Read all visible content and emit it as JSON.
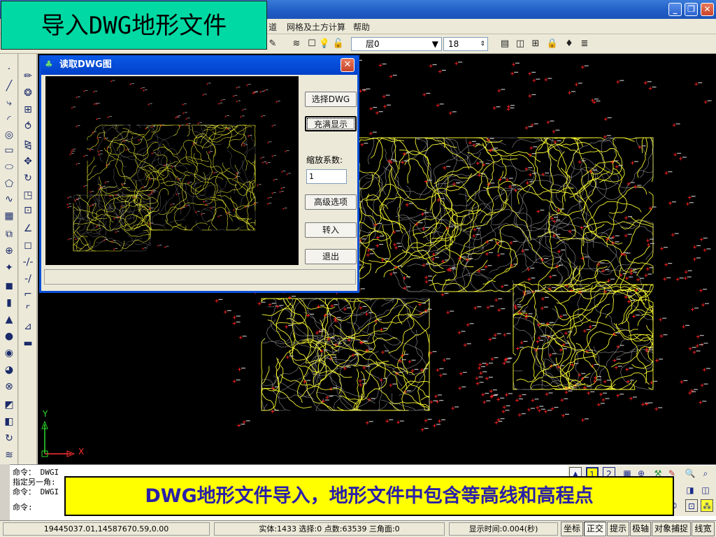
{
  "heading": "导入DWG地形文件",
  "menu": {
    "items": [
      "道",
      "网格及土方计算",
      "帮助"
    ]
  },
  "toolbar": {
    "layer": "层0",
    "size": "18"
  },
  "dialog": {
    "title": "读取DWG图",
    "buttons": [
      "选择DWG",
      "充满显示",
      "高级选项",
      "转入",
      "退出"
    ],
    "zoom_label": "缩放系数:",
    "zoom_value": "1"
  },
  "command": {
    "lines": [
      "命令： DWGI",
      "指定另一角:",
      "命令： DWGI"
    ],
    "prompt": "命令:"
  },
  "caption": "DWG地形文件导入，地形文件中包含等高线和高程点",
  "axis": {
    "y": "Y",
    "x": "X"
  },
  "status": {
    "coords": "19445037.01,14587670.59,0.00",
    "info": "实体:1433 选择:0 点数:63539 三角面:0",
    "time": "显示时间:0.004(秒)",
    "buttons": [
      "坐标",
      "正交",
      "提示",
      "极轴",
      "对象捕捉",
      "线宽"
    ]
  },
  "colors": {
    "contour": "#ffff33",
    "point": "#ff2020",
    "canvas": "#000000"
  }
}
